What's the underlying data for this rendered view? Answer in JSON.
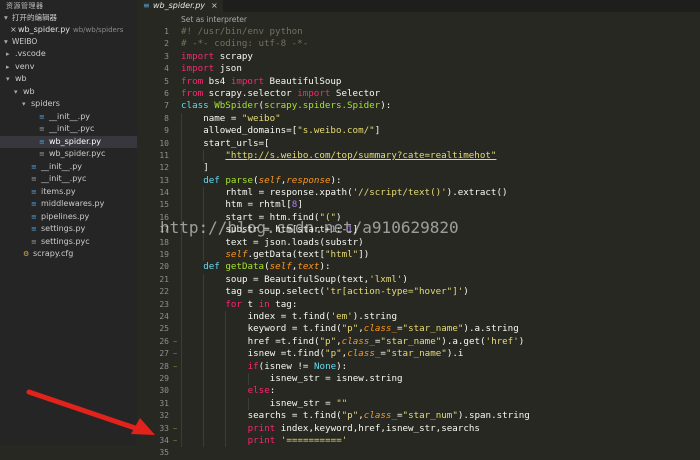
{
  "sidebar": {
    "title": "资源管理器",
    "open_editors_label": "打开的编辑器",
    "open_file": {
      "name": "wb_spider.py",
      "path": "wb/wb/spiders"
    },
    "workspace_label": "WEIBO",
    "tree": [
      {
        "name": ".vscode",
        "depth": 1,
        "arrow": "▸",
        "icon": ""
      },
      {
        "name": "venv",
        "depth": 1,
        "arrow": "▸",
        "icon": ""
      },
      {
        "name": "wb",
        "depth": 1,
        "arrow": "▾",
        "icon": ""
      },
      {
        "name": "wb",
        "depth": 2,
        "arrow": "▾",
        "icon": ""
      },
      {
        "name": "spiders",
        "depth": 3,
        "arrow": "▾",
        "icon": ""
      },
      {
        "name": "__init__.py",
        "depth": 4,
        "arrow": "",
        "icon": "py"
      },
      {
        "name": "__init__.pyc",
        "depth": 4,
        "arrow": "",
        "icon": "file"
      },
      {
        "name": "wb_spider.py",
        "depth": 4,
        "arrow": "",
        "icon": "py",
        "active": true
      },
      {
        "name": "wb_spider.pyc",
        "depth": 4,
        "arrow": "",
        "icon": "file"
      },
      {
        "name": "__init__.py",
        "depth": 3,
        "arrow": "",
        "icon": "py"
      },
      {
        "name": "__init__.pyc",
        "depth": 3,
        "arrow": "",
        "icon": "file"
      },
      {
        "name": "items.py",
        "depth": 3,
        "arrow": "",
        "icon": "py"
      },
      {
        "name": "middlewares.py",
        "depth": 3,
        "arrow": "",
        "icon": "py"
      },
      {
        "name": "pipelines.py",
        "depth": 3,
        "arrow": "",
        "icon": "py"
      },
      {
        "name": "settings.py",
        "depth": 3,
        "arrow": "",
        "icon": "py"
      },
      {
        "name": "settings.pyc",
        "depth": 3,
        "arrow": "",
        "icon": "file"
      },
      {
        "name": "scrapy.cfg",
        "depth": 2,
        "arrow": "",
        "icon": "cfg"
      }
    ]
  },
  "tab": {
    "name": "wb_spider.py",
    "close": "×"
  },
  "editor": {
    "hint": "Set as interpreter",
    "watermark": "http://blog.csdn.net/a910629820",
    "lines": [
      {
        "n": 1,
        "mark": "",
        "indent": 0,
        "tokens": [
          [
            "cm",
            "#! /usr/bin/env python"
          ]
        ]
      },
      {
        "n": 2,
        "mark": "",
        "indent": 0,
        "tokens": [
          [
            "cm",
            "# -*- coding: utf-8 -*-"
          ]
        ]
      },
      {
        "n": 3,
        "mark": "",
        "indent": 0,
        "tokens": [
          [
            "kw",
            "import"
          ],
          [
            "",
            " scrapy"
          ]
        ]
      },
      {
        "n": 4,
        "mark": "",
        "indent": 0,
        "tokens": [
          [
            "kw",
            "import"
          ],
          [
            "",
            " json"
          ]
        ]
      },
      {
        "n": 5,
        "mark": "",
        "indent": 0,
        "tokens": [
          [
            "kw",
            "from"
          ],
          [
            "",
            " bs4 "
          ],
          [
            "kw",
            "import"
          ],
          [
            "",
            " BeautifulSoup"
          ]
        ]
      },
      {
        "n": 6,
        "mark": "",
        "indent": 0,
        "tokens": [
          [
            "kw",
            "from"
          ],
          [
            "",
            " scrapy.selector "
          ],
          [
            "kw",
            "import"
          ],
          [
            "",
            " Selector"
          ]
        ]
      },
      {
        "n": 7,
        "mark": "",
        "indent": 0,
        "tokens": [
          [
            "bi",
            "class"
          ],
          [
            "",
            " "
          ],
          [
            "fn",
            "WbSpider"
          ],
          [
            "",
            "("
          ],
          [
            "fn",
            "scrapy.spiders.Spider"
          ],
          [
            "",
            "):"
          ]
        ]
      },
      {
        "n": 8,
        "mark": "",
        "indent": 1,
        "tokens": [
          [
            "",
            "name = "
          ],
          [
            "st",
            "\"weibo\""
          ]
        ]
      },
      {
        "n": 9,
        "mark": "",
        "indent": 1,
        "tokens": [
          [
            "",
            "allowed_domains=["
          ],
          [
            "st",
            "\"s.weibo.com/\""
          ],
          [
            "",
            "]"
          ]
        ]
      },
      {
        "n": 10,
        "mark": "",
        "indent": 1,
        "tokens": [
          [
            "",
            "start_urls=["
          ]
        ]
      },
      {
        "n": 11,
        "mark": "",
        "indent": 2,
        "tokens": [
          [
            "st ul",
            "\"http://s.weibo.com/top/summary?cate=realtimehot\""
          ]
        ]
      },
      {
        "n": 12,
        "mark": "",
        "indent": 1,
        "tokens": [
          [
            "",
            "]"
          ]
        ]
      },
      {
        "n": 13,
        "mark": "",
        "indent": 1,
        "tokens": [
          [
            "bi",
            "def"
          ],
          [
            "",
            " "
          ],
          [
            "fn",
            "parse"
          ],
          [
            "",
            "("
          ],
          [
            "pm",
            "self"
          ],
          [
            "",
            ","
          ],
          [
            "pm",
            "response"
          ],
          [
            "",
            "):"
          ]
        ]
      },
      {
        "n": 14,
        "mark": "",
        "indent": 2,
        "tokens": [
          [
            "",
            "rhtml = response.xpath("
          ],
          [
            "st",
            "'//script/text()'"
          ],
          [
            "",
            ").extract()"
          ]
        ]
      },
      {
        "n": 15,
        "mark": "",
        "indent": 2,
        "tokens": [
          [
            "",
            "htm = rhtml["
          ],
          [
            "num",
            "8"
          ],
          [
            "",
            "]"
          ]
        ]
      },
      {
        "n": 16,
        "mark": "",
        "indent": 2,
        "tokens": [
          [
            "",
            "start = htm.find("
          ],
          [
            "st",
            "\"(\""
          ],
          [
            "",
            ")"
          ]
        ]
      },
      {
        "n": 17,
        "mark": "",
        "indent": 2,
        "tokens": [
          [
            "",
            "substr = htm[start+"
          ],
          [
            "num",
            "1"
          ],
          [
            "",
            ":-"
          ],
          [
            "num",
            "1"
          ],
          [
            "",
            "]"
          ]
        ]
      },
      {
        "n": 18,
        "mark": "",
        "indent": 2,
        "tokens": [
          [
            "",
            "text = json.loads(substr)"
          ]
        ]
      },
      {
        "n": 19,
        "mark": "",
        "indent": 2,
        "tokens": [
          [
            "pm",
            "self"
          ],
          [
            "",
            ".getData(text["
          ],
          [
            "st",
            "\"html\""
          ],
          [
            "",
            "])"
          ]
        ]
      },
      {
        "n": 20,
        "mark": "",
        "indent": 1,
        "tokens": [
          [
            "bi",
            "def"
          ],
          [
            "",
            " "
          ],
          [
            "fn",
            "getData"
          ],
          [
            "",
            "("
          ],
          [
            "pm",
            "self"
          ],
          [
            "",
            ","
          ],
          [
            "pm",
            "text"
          ],
          [
            "",
            "):"
          ]
        ]
      },
      {
        "n": 21,
        "mark": "",
        "indent": 2,
        "tokens": [
          [
            "",
            "soup = BeautifulSoup(text,"
          ],
          [
            "st",
            "'lxml'"
          ],
          [
            "",
            ")"
          ]
        ]
      },
      {
        "n": 22,
        "mark": "",
        "indent": 2,
        "tokens": [
          [
            "",
            "tag = soup.select("
          ],
          [
            "st",
            "'tr[action-type=\"hover\"]'"
          ],
          [
            "",
            ")"
          ]
        ]
      },
      {
        "n": 23,
        "mark": "",
        "indent": 2,
        "tokens": [
          [
            "kw",
            "for"
          ],
          [
            "",
            " t "
          ],
          [
            "kw",
            "in"
          ],
          [
            "",
            " tag:"
          ]
        ]
      },
      {
        "n": 24,
        "mark": "",
        "indent": 3,
        "tokens": [
          [
            "",
            "index = t.find("
          ],
          [
            "st",
            "'em'"
          ],
          [
            "",
            ").string"
          ]
        ]
      },
      {
        "n": 25,
        "mark": "",
        "indent": 3,
        "tokens": [
          [
            "",
            "keyword = t.find("
          ],
          [
            "st",
            "\"p\""
          ],
          [
            "",
            ","
          ],
          [
            "pm",
            "class_"
          ],
          [
            "",
            "="
          ],
          [
            "st",
            "\"star_name\""
          ],
          [
            "",
            ").a.string"
          ]
        ]
      },
      {
        "n": 26,
        "mark": "~",
        "indent": 3,
        "tokens": [
          [
            "",
            "href =t.find("
          ],
          [
            "st",
            "\"p\""
          ],
          [
            "",
            ","
          ],
          [
            "pm",
            "class_"
          ],
          [
            "",
            "="
          ],
          [
            "st",
            "\"star_name\""
          ],
          [
            "",
            ").a.get("
          ],
          [
            "st",
            "'href'"
          ],
          [
            "",
            ")"
          ]
        ]
      },
      {
        "n": 27,
        "mark": "~",
        "indent": 3,
        "tokens": [
          [
            "",
            "isnew =t.find("
          ],
          [
            "st",
            "\"p\""
          ],
          [
            "",
            ","
          ],
          [
            "pm",
            "class_"
          ],
          [
            "",
            "="
          ],
          [
            "st",
            "\"star_name\""
          ],
          [
            "",
            ").i"
          ]
        ]
      },
      {
        "n": 28,
        "mark": "~",
        "indent": 3,
        "tokens": [
          [
            "kw",
            "if"
          ],
          [
            "",
            "(isnew != "
          ],
          [
            "bi",
            "None"
          ],
          [
            "",
            "):"
          ]
        ]
      },
      {
        "n": 29,
        "mark": "",
        "indent": 4,
        "tokens": [
          [
            "",
            "isnew_str = isnew.string"
          ]
        ]
      },
      {
        "n": 30,
        "mark": "",
        "indent": 3,
        "tokens": [
          [
            "kw",
            "else"
          ],
          [
            "",
            ":"
          ]
        ]
      },
      {
        "n": 31,
        "mark": "",
        "indent": 4,
        "tokens": [
          [
            "",
            "isnew_str = "
          ],
          [
            "st",
            "\"\""
          ]
        ]
      },
      {
        "n": 32,
        "mark": "",
        "indent": 3,
        "tokens": [
          [
            "",
            "searchs = t.find("
          ],
          [
            "st",
            "\"p\""
          ],
          [
            "",
            ","
          ],
          [
            "pm",
            "class_"
          ],
          [
            "",
            "="
          ],
          [
            "st",
            "\"star_num\""
          ],
          [
            "",
            ").span.string"
          ]
        ]
      },
      {
        "n": 33,
        "mark": "~",
        "indent": 3,
        "tokens": [
          [
            "kw",
            "print"
          ],
          [
            "",
            " index,keyword,href,isnew_str,searchs"
          ]
        ]
      },
      {
        "n": 34,
        "mark": "~",
        "indent": 3,
        "tokens": [
          [
            "kw",
            "print"
          ],
          [
            "",
            " "
          ],
          [
            "st",
            "'=========='"
          ]
        ]
      },
      {
        "n": 35,
        "mark": "",
        "indent": 0,
        "tokens": []
      }
    ]
  },
  "colors": {
    "background": "#272822",
    "sidebar": "#252526",
    "keyword": "#f92672",
    "string": "#e6db74",
    "function": "#a6e22e",
    "arrow": "#e3231b"
  },
  "icons": {
    "file_python": "python-file-icon",
    "file_generic": "file-icon",
    "arrow_annotation": "red-arrow-icon"
  }
}
